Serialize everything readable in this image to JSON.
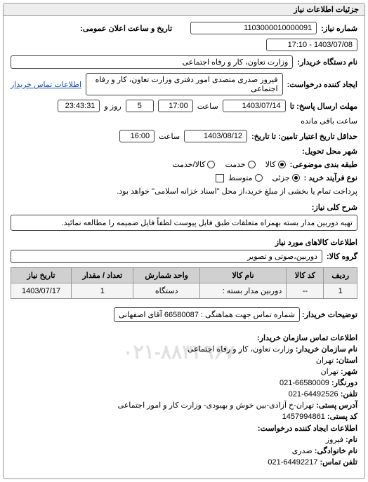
{
  "panel": {
    "title": "جزئیات اطلاعات نیاز"
  },
  "header": {
    "need_no_label": "شماره نیاز:",
    "need_no": "1103000010000091",
    "announce_label": "تاریخ و ساعت اعلان عمومی:",
    "announce_value": "1403/07/08 - 17:10",
    "buyer_org_label": "نام دستگاه خریدار:",
    "buyer_org": "وزارت تعاون، کار و رفاه اجتماعی",
    "requester_label": "ایجاد کننده درخواست:",
    "requester": "فیروز صدری متصدی امور دفتری وزارت تعاون، کار و رفاه اجتماعی",
    "contact_link": "اطلاعات تماس خریدار"
  },
  "deadlines": {
    "reply_deadline_label": "مهلت ارسال پاسخ: تا",
    "reply_date": "1403/07/14",
    "reply_time_label": "ساعت",
    "reply_time": "17:00",
    "remain_days": "5",
    "remain_days_label": "روز و",
    "remain_time": "23:43:31",
    "remain_suffix": "ساعت باقی مانده",
    "validity_label": "حداقل تاریخ اعتبار تامین: تا تاریخ:",
    "validity_date": "1403/08/12",
    "validity_time_label": "ساعت",
    "validity_time": "16:00"
  },
  "delivery": {
    "city_label": "شهر محل تحویل:",
    "item_level_label": "طبقه بندی موضوعی:",
    "radios": {
      "kala": "کالا",
      "khadmat": "خدمت",
      "kala_khadmat": "کالا/خدمت"
    },
    "process_label": "نوع فرآیند خرید :",
    "process_options": {
      "jozi": "جزئی",
      "motvaset": "متوسط"
    },
    "process_note": "پرداخت تمام یا بخشی از مبلغ خرید،از محل \"اسناد خزانه اسلامی\" خواهد بود."
  },
  "need_desc": {
    "label": "شرح کلی نیاز:",
    "text": "تهیه دوربین مدار بسته بهمراه متعلقات طبق فایل پیوست لطفاً فایل ضمیمه را مطالعه نمائید."
  },
  "goods": {
    "section_title": "اطلاعات کالاهای مورد نیاز",
    "group_label": "گروه کالا:",
    "group_value": "دوربین،صوتی و تصویر",
    "table": {
      "headers": {
        "row": "ردیف",
        "code": "کد کالا",
        "name": "نام کالا",
        "unit": "واحد شمارش",
        "qty": "تعداد / مقدار",
        "date": "تاریخ نیاز"
      },
      "rows": [
        {
          "row": "1",
          "code": "--",
          "name": "دوربین مدار بسته :",
          "unit": "دستگاه",
          "qty": "1",
          "date": "1403/07/17"
        }
      ]
    }
  },
  "buyer_notes": {
    "label": "توضیحات خریدار:",
    "text": "شماره تماس جهت هماهنگی : 66580087 آقای اصفهانی"
  },
  "contact": {
    "section_title": "اطلاعات تماس سازمان خریدار:",
    "org_label": "نام سازمان خریدار:",
    "org": "وزارت تعاون، کار و رفاه اجتماعی",
    "province_label": "استان:",
    "province": "تهران",
    "city_label": "شهر:",
    "city": "تهران",
    "fax_label": "دورنگار:",
    "fax": "66580009-021",
    "phone_label": "تلفن:",
    "phone": "64492526-021",
    "address_label": "آدرس پستی:",
    "address": "تهران-خ آزادی-بین خوش و بهبودی- وزارت کار و امور اجتماعی",
    "postal_label": "کد پستی:",
    "postal": "1457994861",
    "creator_section": "اطلاعات ایجاد کننده درخواست:",
    "name_label": "نام:",
    "name": "فیروز",
    "family_label": "نام خانوادگی:",
    "family": "صدری",
    "cphone_label": "تلفن تماس:",
    "cphone": "64492217-021",
    "watermark": "۰۲۱-۸۸۳۴۹۶۷۰"
  }
}
